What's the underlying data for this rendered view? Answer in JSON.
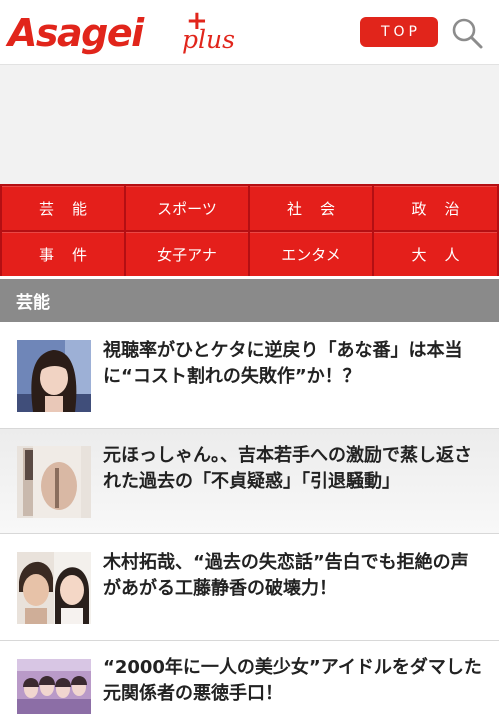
{
  "header": {
    "logo_text": "Asagei",
    "logo_plus": "plus",
    "logo_cross": "+",
    "top_button": "TOP",
    "search_icon": "search-icon",
    "accent_color": "#e1251b"
  },
  "categories": [
    {
      "label": "芸能"
    },
    {
      "label": "スポーツ"
    },
    {
      "label": "社会"
    },
    {
      "label": "政治"
    },
    {
      "label": "事件"
    },
    {
      "label": "女子アナ"
    },
    {
      "label": "エンタメ"
    },
    {
      "label": "大人"
    }
  ],
  "section": {
    "title": "芸能"
  },
  "articles": [
    {
      "title": "視聴率がひとケタに逆戻り「あな番」は本当に“コスト割れの失敗作”か！？"
    },
    {
      "title": "元ほっしゃん。、吉本若手への激励で蒸し返された過去の「不貞疑惑」「引退騒動」"
    },
    {
      "title": "木村拓哉、“過去の失恋話”告白でも拒絶の声があがる工藤静香の破壊力！"
    },
    {
      "title": "“2000年に一人の美少女”アイドルをダマした元関係者の悪徳手口！"
    }
  ]
}
